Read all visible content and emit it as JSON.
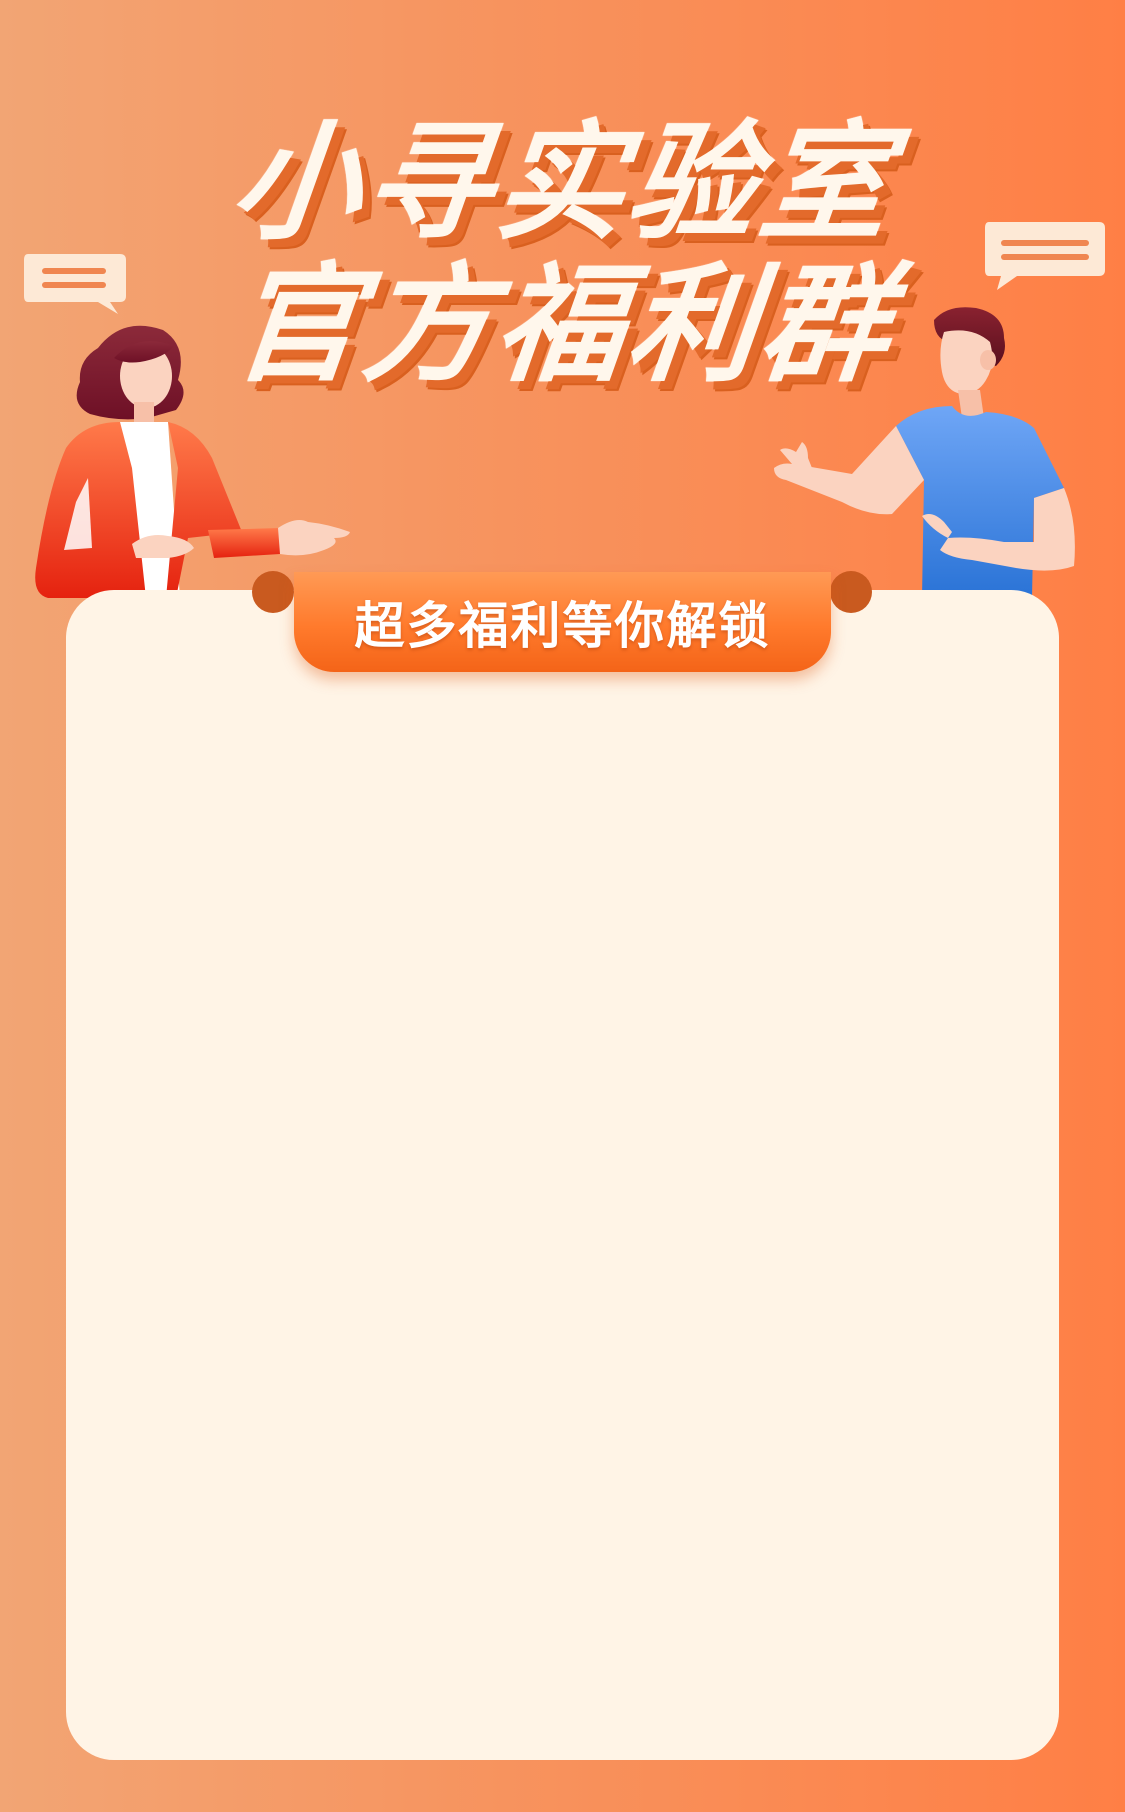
{
  "title": {
    "line1": "小寻实验室",
    "line2": "官方福利群"
  },
  "banner": {
    "label": "超多福利等你解锁"
  },
  "colors": {
    "background_left": "#f2a574",
    "background_right": "#ff7f45",
    "card": "#fff4e6",
    "tab_accent": "#ff7a2c",
    "title_text": "#fff7ec",
    "title_shadow": "#e36a2b"
  },
  "illustrations": {
    "left_character": "woman-presenting-illustration",
    "right_character": "man-presenting-illustration",
    "left_bubble": "speech-bubble-icon",
    "right_bubble": "speech-bubble-icon"
  }
}
